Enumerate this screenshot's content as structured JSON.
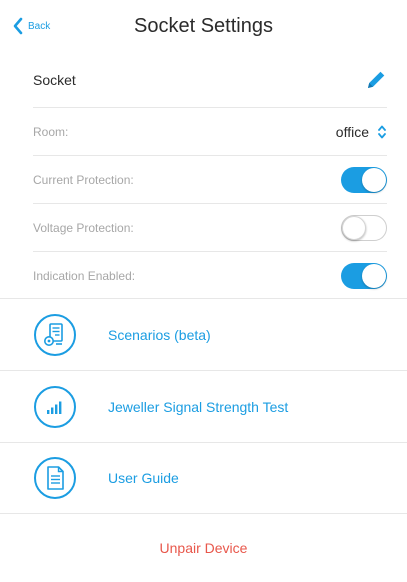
{
  "nav": {
    "back_label": "Back",
    "title": "Socket Settings",
    "back_icon": "chevron-left-icon"
  },
  "settings": {
    "name": "Socket",
    "edit_icon": "pencil-icon",
    "room": {
      "label": "Room:",
      "value": "office",
      "icon": "up-down-chevron-icon"
    },
    "current_protection": {
      "label": "Current Protection:",
      "enabled": true
    },
    "voltage_protection": {
      "label": "Voltage Protection:",
      "enabled": false
    },
    "indication": {
      "label": "Indication Enabled:",
      "enabled": true
    }
  },
  "actions": [
    {
      "label": "Scenarios (beta)",
      "icon": "scenarios-icon"
    },
    {
      "label": "Jeweller Signal Strength Test",
      "icon": "signal-strength-icon"
    },
    {
      "label": "User Guide",
      "icon": "user-guide-icon"
    }
  ],
  "unpair_label": "Unpair Device",
  "colors": {
    "accent": "#1b9de2",
    "danger": "#e8574b",
    "divider": "#e7e7e7",
    "muted_text": "#a7a7a7"
  }
}
